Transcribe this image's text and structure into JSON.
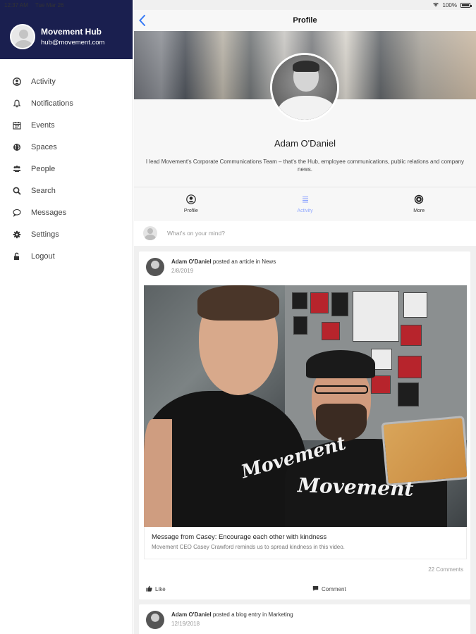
{
  "status": {
    "time": "12:37 AM",
    "date": "Tue Mar 26",
    "battery": "100%"
  },
  "sidebar": {
    "user": {
      "name": "Movement Hub",
      "email": "hub@movement.com"
    },
    "items": [
      {
        "label": "Activity",
        "icon": "activity-icon"
      },
      {
        "label": "Notifications",
        "icon": "bell-icon"
      },
      {
        "label": "Events",
        "icon": "calendar-icon"
      },
      {
        "label": "Spaces",
        "icon": "globe-icon"
      },
      {
        "label": "People",
        "icon": "people-icon"
      },
      {
        "label": "Search",
        "icon": "search-icon"
      },
      {
        "label": "Messages",
        "icon": "message-icon"
      },
      {
        "label": "Settings",
        "icon": "gear-icon"
      },
      {
        "label": "Logout",
        "icon": "lock-icon"
      }
    ]
  },
  "navbar": {
    "title": "Profile"
  },
  "profile": {
    "name": "Adam O'Daniel",
    "bio": "I lead Movement's Corporate Communications Team – that's the Hub, employee communications, public relations and company news."
  },
  "tabs": [
    {
      "label": "Profile",
      "active": false
    },
    {
      "label": "Activity",
      "active": true
    },
    {
      "label": "More",
      "active": false
    }
  ],
  "composer": {
    "placeholder": "What's on your mind?"
  },
  "posts": [
    {
      "author": "Adam O'Daniel",
      "action": "posted an article in News",
      "date": "2/8/2019",
      "title": "Message from Casey: Encourage each other with kindness",
      "subtitle": "Movement CEO Casey Crawford reminds us to spread kindness in this video.",
      "shirt_text_1": "Movement",
      "shirt_text_2": "Movement",
      "comments": "22 Comments",
      "like_label": "Like",
      "comment_label": "Comment"
    },
    {
      "author": "Adam O'Daniel",
      "action": "posted a blog entry in Marketing",
      "date": "12/19/2018"
    }
  ],
  "colors": {
    "sidebar_header": "#1a1f4f",
    "accent": "#3478f6",
    "active_tab": "#8fa7ff"
  }
}
